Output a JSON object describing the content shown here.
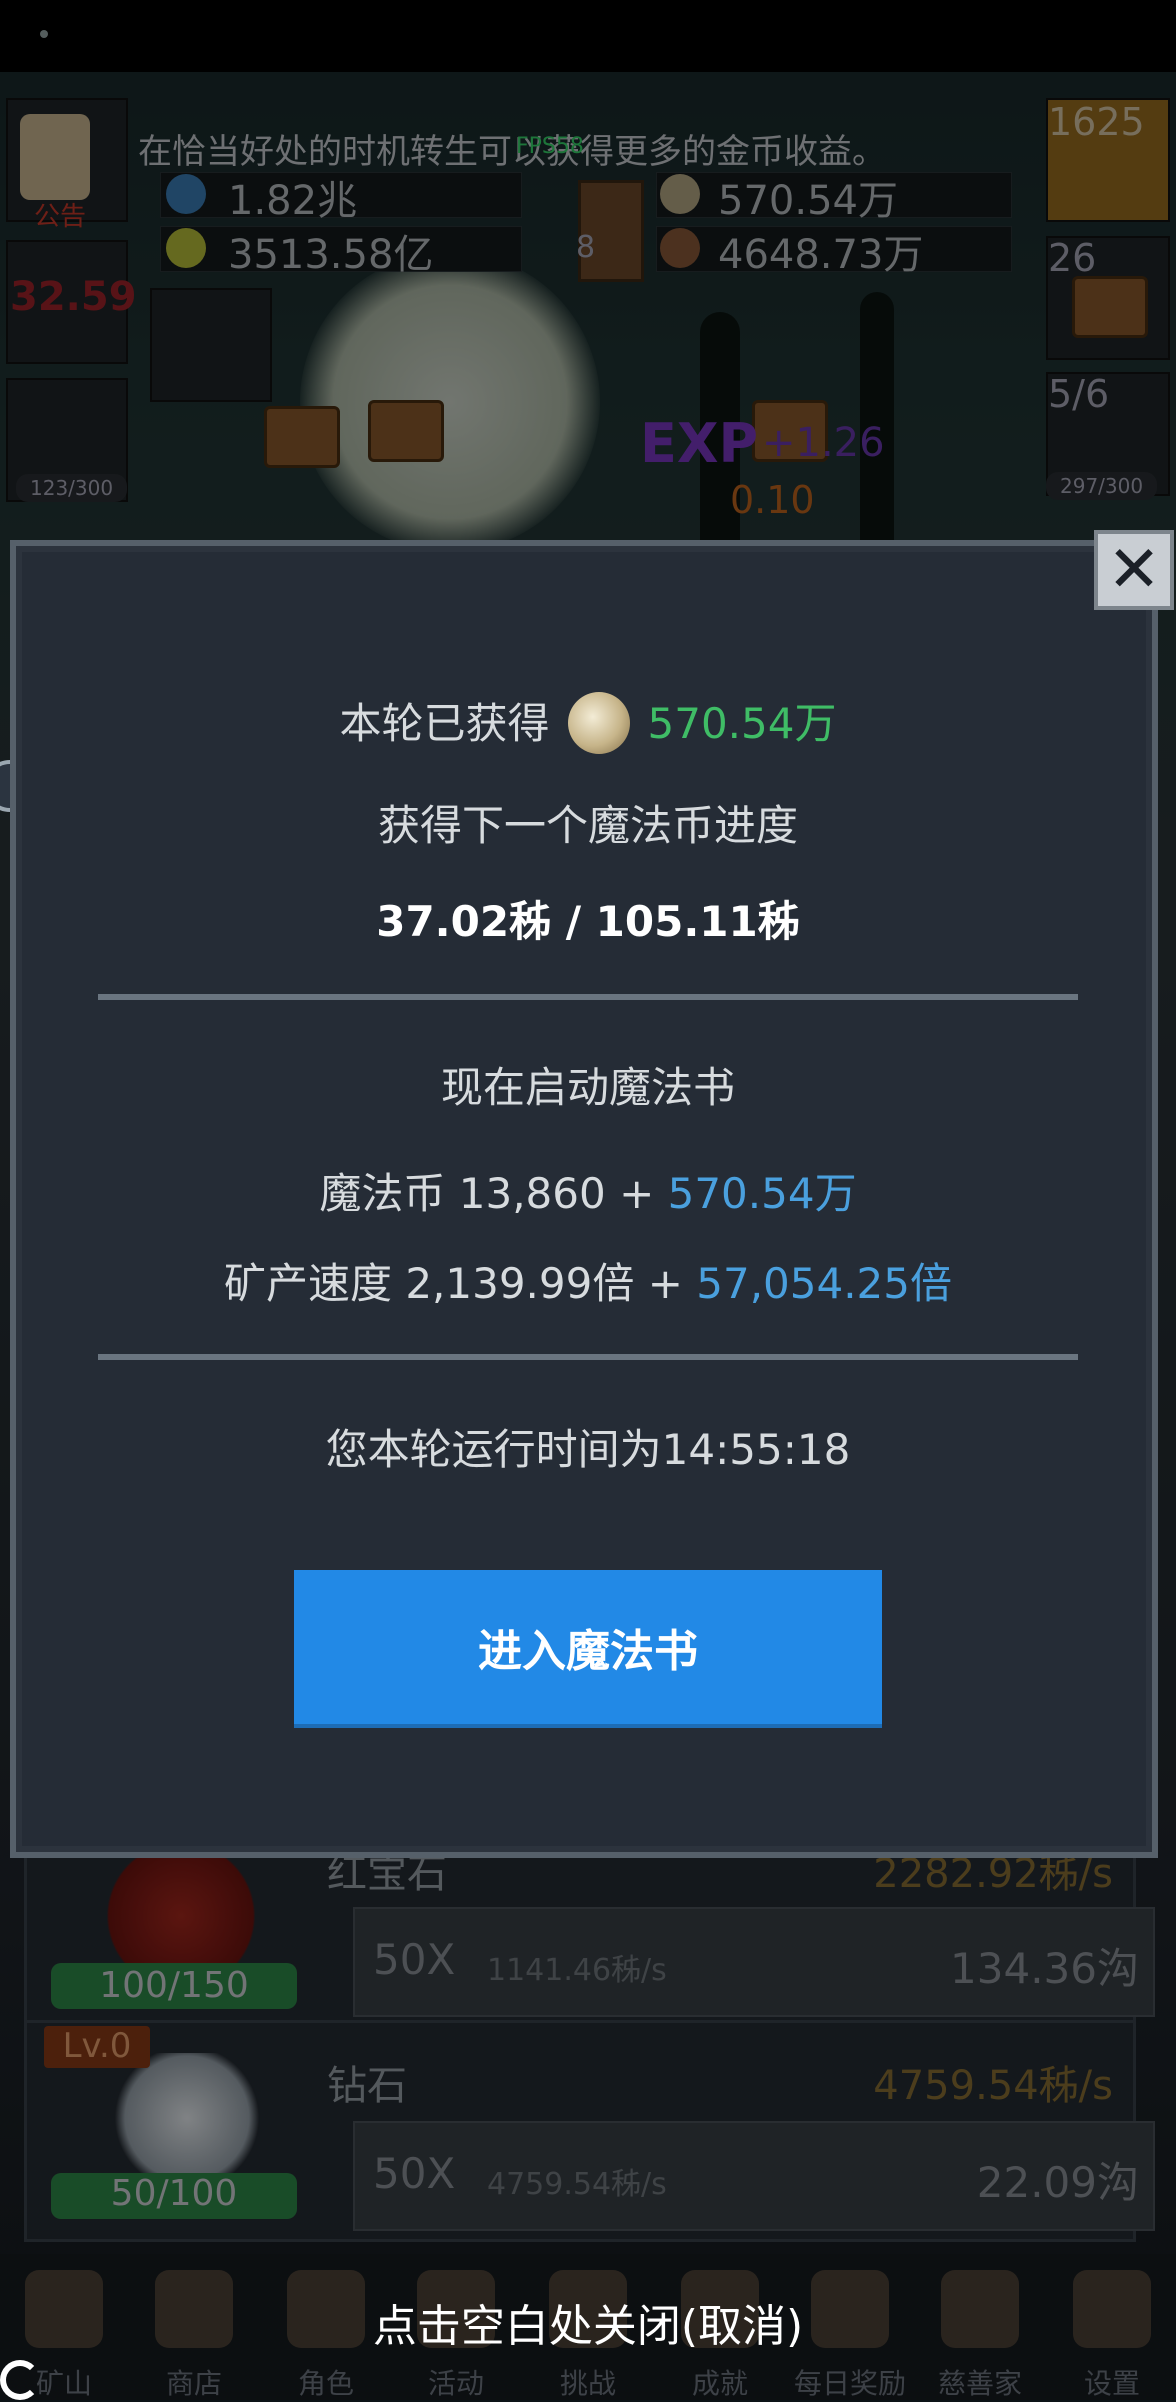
{
  "hud": {
    "notice_label": "公告",
    "ticker": "在恰当好处的时机转生可以获得更多的金币收益。",
    "fps": "FPS58",
    "left_counter_1": "32.59",
    "left_counter_2": "123/300",
    "resources": {
      "potion_blue": "1.82兆",
      "potion_green": "3513.58亿",
      "coin": "570.54万",
      "meat": "4648.73万",
      "book_count": "8"
    },
    "right": {
      "top_value": "1625",
      "chest_count": "26",
      "bush_count": "5/6",
      "bush_counter": "297/300"
    },
    "scene": {
      "exp_label": "EXP",
      "exp_plus": "+1.26",
      "exp_orange": "0.10"
    }
  },
  "modal": {
    "earned_label": "本轮已获得",
    "earned_value": "570.54万",
    "progress_title": "获得下一个魔法币进度",
    "progress_value": "37.02秭 / 105.11秭",
    "activate_title": "现在启动魔法书",
    "magic_coin_prefix": "魔法币 13,860 + ",
    "magic_coin_add": "570.54万",
    "speed_prefix": "矿产速度 2,139.99倍 + ",
    "speed_add": "57,054.25倍",
    "runtime": "您本轮运行时间为14:55:18",
    "enter_button": "进入魔法书",
    "close_icon_glyph": "✕"
  },
  "cards": [
    {
      "title": "红宝石",
      "rate": "2282.92秭/s",
      "progress": "100/150",
      "multiplier": "50X",
      "sub_rate": "1141.46秭/s",
      "cost": "134.36沟"
    },
    {
      "level": "Lv.0",
      "title": "钻石",
      "rate": "4759.54秭/s",
      "progress": "50/100",
      "multiplier": "50X",
      "sub_rate": "4759.54秭/s",
      "cost": "22.09沟"
    }
  ],
  "nav": [
    {
      "label": "矿山",
      "icon": "lantern-icon"
    },
    {
      "label": "商店",
      "icon": "shop-icon"
    },
    {
      "label": "角色",
      "icon": "skull-icon"
    },
    {
      "label": "活动",
      "icon": "activity-icon"
    },
    {
      "label": "挑战",
      "icon": "challenge-icon"
    },
    {
      "label": "成就",
      "icon": "key-icon"
    },
    {
      "label": "每日奖励",
      "icon": "envelope-icon"
    },
    {
      "label": "慈善家",
      "icon": "bread-icon"
    },
    {
      "label": "设置",
      "icon": "gear-icon"
    }
  ],
  "close_hint": "点击空白处关闭(取消)",
  "colors": {
    "green": "#3fbd66",
    "blue": "#4aa0de",
    "button_blue": "#2289e6",
    "modal_bg": "#252c36"
  }
}
